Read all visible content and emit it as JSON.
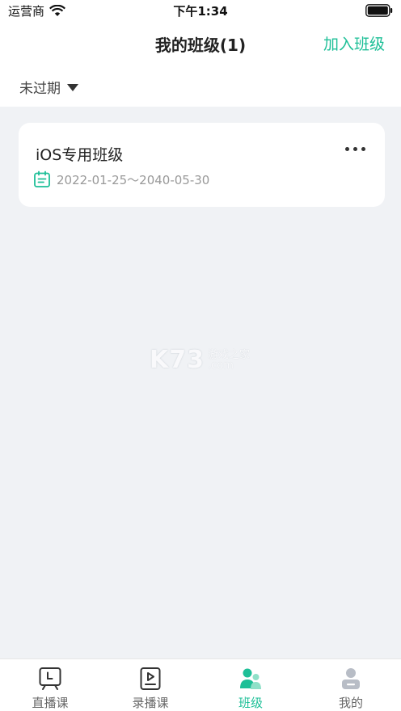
{
  "status_bar": {
    "carrier": "运营商",
    "time": "下午1:34"
  },
  "header": {
    "title": "我的班级(1)",
    "join_label": "加入班级"
  },
  "filter": {
    "selected": "未过期"
  },
  "classes": [
    {
      "name": "iOS专用班级",
      "date_range": "2022-01-25～2040-05-30"
    }
  ],
  "watermark": {
    "main": "K73",
    "sub1": "游戏之家",
    "sub2": ".com"
  },
  "tabs": [
    {
      "label": "直播课",
      "icon": "live-class-icon",
      "active": false
    },
    {
      "label": "录播课",
      "icon": "recorded-class-icon",
      "active": false
    },
    {
      "label": "班级",
      "icon": "class-group-icon",
      "active": true
    },
    {
      "label": "我的",
      "icon": "profile-icon",
      "active": false
    }
  ],
  "colors": {
    "accent": "#1dbf97",
    "background": "#f0f2f5",
    "inactive_icon": "#b8bdc6"
  }
}
